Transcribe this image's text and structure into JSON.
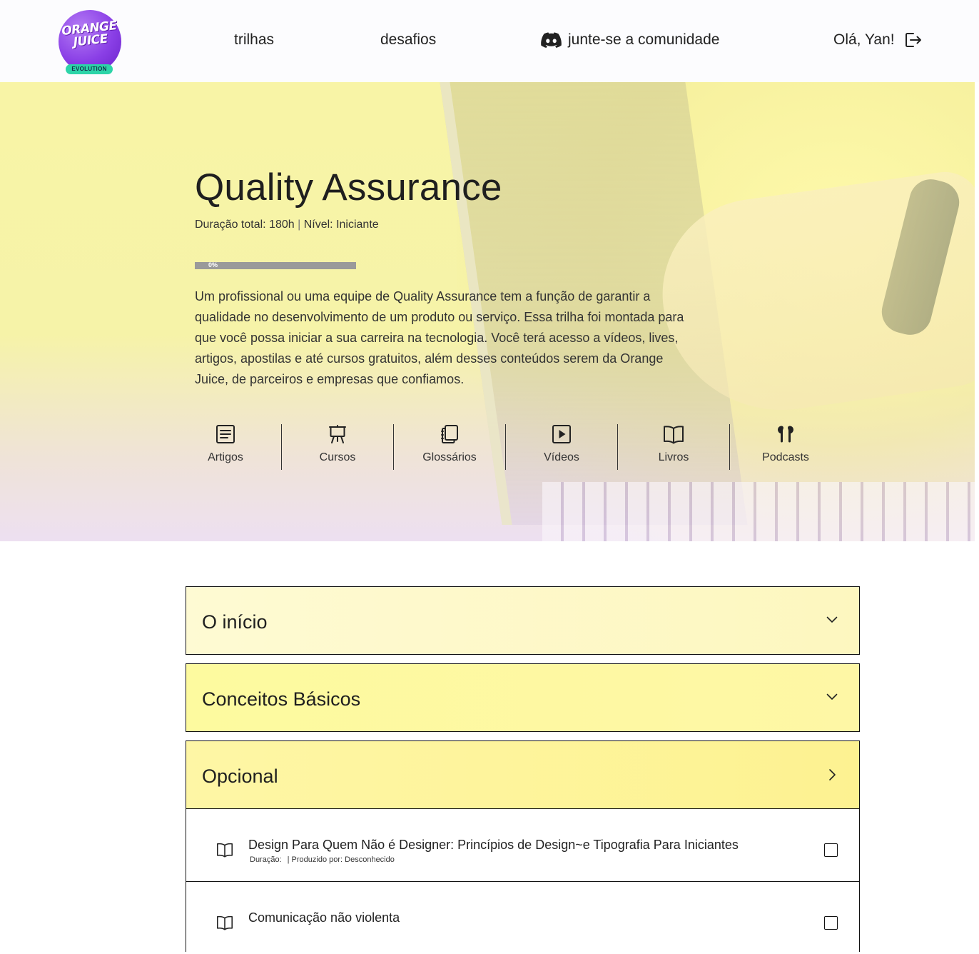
{
  "header": {
    "logo": {
      "line1": "ORANGE",
      "line2": "JUICE",
      "badge": "EVOLUTION"
    },
    "nav": {
      "trilhas": "trilhas",
      "desafios": "desafios",
      "community": "junte-se a comunidade",
      "community_icon": "discord-icon"
    },
    "user": {
      "greeting": "Olá, Yan!",
      "logout_icon": "logout-icon"
    }
  },
  "hero": {
    "title": "Quality Assurance",
    "duration_label": "Duração total: 180h",
    "separator": "|",
    "level_label": "Nível: Iniciante",
    "progress": {
      "value": 0,
      "label": "0%"
    },
    "description": "Um profissional ou uma equipe de Quality Assurance tem a função de garantir a qualidade no desenvolvimento de um produto ou serviço. Essa trilha foi montada para que você possa iniciar a sua carreira na tecnologia. Você terá acesso a vídeos, lives, artigos, apostilas e até cursos gratuitos, além desses conteúdos serem da Orange Juice, de parceiros e empresas que confiamos.",
    "content_types": [
      {
        "label": "Artigos",
        "icon": "article-icon"
      },
      {
        "label": "Cursos",
        "icon": "course-easel-icon"
      },
      {
        "label": "Glossários",
        "icon": "glossary-icon"
      },
      {
        "label": "Vídeos",
        "icon": "video-play-icon"
      },
      {
        "label": "Livros",
        "icon": "book-icon"
      },
      {
        "label": "Podcasts",
        "icon": "earbuds-icon"
      }
    ]
  },
  "sections": [
    {
      "title": "O início",
      "state": "collapsed",
      "icon": "chevron-down-icon"
    },
    {
      "title": "Conceitos Básicos",
      "state": "collapsed",
      "icon": "chevron-down-icon"
    },
    {
      "title": "Opcional",
      "state": "expanded",
      "icon": "chevron-right-icon"
    }
  ],
  "resources": [
    {
      "title": "Design Para Quem Não é Designer: Princípios de Design~e Tipografia Para Iniciantes",
      "duration_label": "Duração:",
      "producer_label": "| Produzido por: Desconhecido",
      "icon": "book-icon",
      "checked": false
    },
    {
      "title": "Comunicação não violenta",
      "icon": "book-icon",
      "checked": false
    }
  ],
  "colors": {
    "brand_purple": "#8a3fe6",
    "brand_green": "#2dd4a8",
    "accordion_yellow": "#fdf291",
    "hero_yellow": "#f8f4a6"
  }
}
